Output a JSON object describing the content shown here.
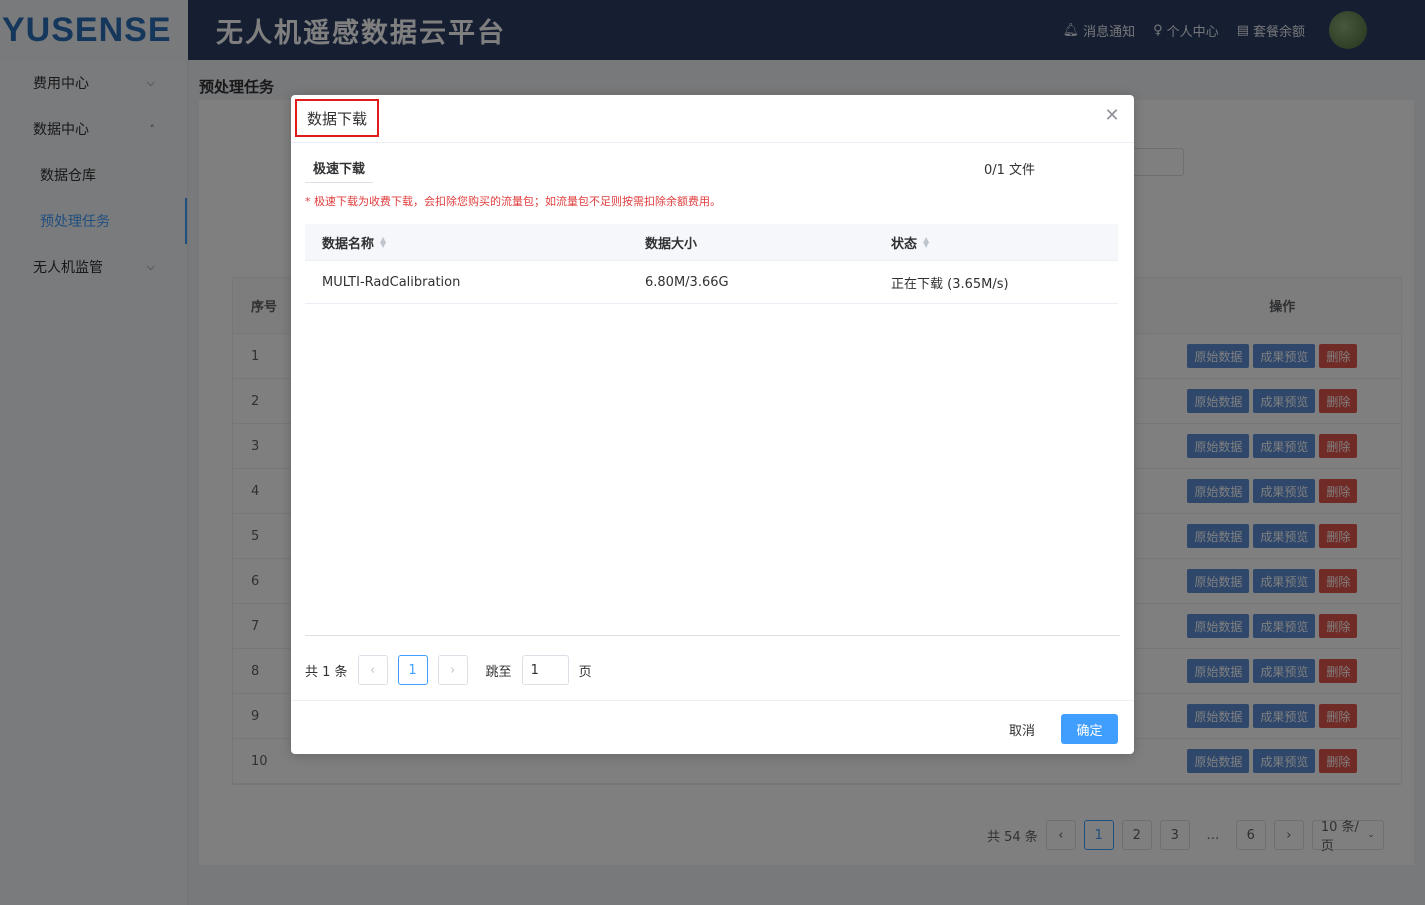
{
  "app": {
    "logo": "YUSENSE",
    "title": "无人机遥感数据云平台",
    "actions": [
      {
        "label": "消息通知",
        "icon": "bell-icon"
      },
      {
        "label": "个人中心",
        "icon": "user-icon"
      },
      {
        "label": "套餐余额",
        "icon": "wallet-icon"
      }
    ]
  },
  "sidebar": {
    "items": [
      {
        "label": "费用中心",
        "expanded": false
      },
      {
        "label": "数据中心",
        "expanded": true
      },
      {
        "label": "数据仓库"
      },
      {
        "label": "预处理任务",
        "active": true
      },
      {
        "label": "无人机监管",
        "expanded": false
      }
    ]
  },
  "page": {
    "title": "预处理任务",
    "table": {
      "header_index": "序号",
      "header_ops": "操作",
      "rows": [
        "1",
        "2",
        "3",
        "4",
        "5",
        "6",
        "7",
        "8",
        "9",
        "10"
      ],
      "op_raw": "原始数据",
      "op_preview": "成果预览",
      "op_delete": "删除"
    },
    "pager": {
      "total": "共 54 条",
      "pages": [
        "1",
        "2",
        "3",
        "…",
        "6"
      ],
      "current": "1",
      "size": "10 条/页"
    }
  },
  "dialog": {
    "title": "数据下载",
    "tab": "极速下载",
    "file_count": "0/1 文件",
    "notice": "* 极速下载为收费下载，会扣除您购买的流量包；如流量包不足则按需扣除余额费用。",
    "columns": {
      "name": "数据名称",
      "size": "数据大小",
      "state": "状态"
    },
    "rows": [
      {
        "name": "MULTI-RadCalibration",
        "size": "6.80M/3.66G",
        "state": "正在下载 (3.65M/s)"
      }
    ],
    "pager": {
      "total": "共 1 条",
      "page": "1",
      "jump_label": "跳至",
      "jump_value": "1",
      "page_unit": "页"
    },
    "cancel": "取消",
    "confirm": "确定"
  },
  "colors": {
    "primary": "#409eff",
    "topbar": "#2d3f63",
    "danger": "#e2574c",
    "highlight": "#e01b1b"
  }
}
